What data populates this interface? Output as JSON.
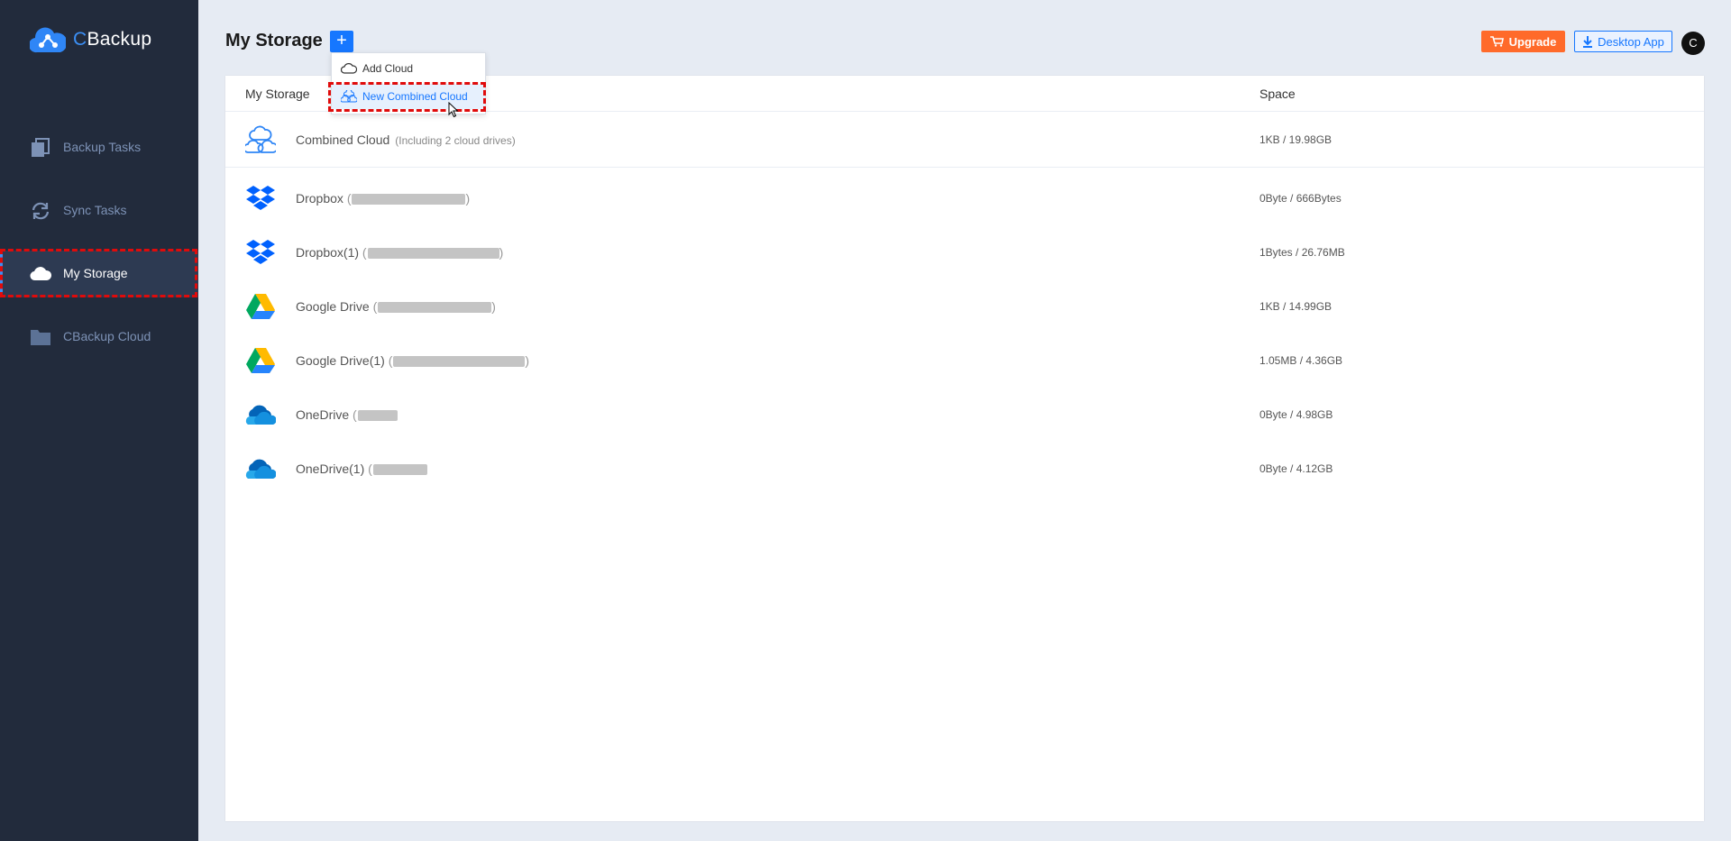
{
  "app": {
    "logo_first": "C",
    "logo_rest": "Backup"
  },
  "colors": {
    "sidebar_bg": "#222b3c",
    "accent": "#1677ff",
    "upgrade": "#ff6a2a",
    "highlight": "#e00b0b"
  },
  "sidebar": {
    "items": [
      {
        "label": "Backup Tasks",
        "icon": "backup-tasks-icon"
      },
      {
        "label": "Sync Tasks",
        "icon": "sync-icon"
      },
      {
        "label": "My Storage",
        "icon": "cloud-icon",
        "active": true
      },
      {
        "label": "CBackup Cloud",
        "icon": "folder-icon"
      }
    ]
  },
  "header": {
    "title": "My Storage",
    "add_label": "+",
    "upgrade_label": "Upgrade",
    "desktop_label": "Desktop App",
    "avatar_letter": "C"
  },
  "dropdown": {
    "items": [
      {
        "label": "Add Cloud",
        "icon": "cloud-outline-icon"
      },
      {
        "label": "New Combined Cloud",
        "icon": "combined-cloud-icon"
      }
    ]
  },
  "table": {
    "col_storage": "My Storage",
    "col_space": "Space",
    "rows": [
      {
        "name": "Combined Cloud",
        "sub": "(Including 2 cloud drives)",
        "space": "1KB / 19.98GB",
        "icon": "combined-cloud-icon"
      },
      {
        "name": "Dropbox",
        "open_paren": "(",
        "close_paren": ")",
        "space": "0Byte / 666Bytes",
        "icon": "dropbox-icon"
      },
      {
        "name": "Dropbox(1)",
        "open_paren": "(",
        "close_paren": ")",
        "space": "1Bytes / 26.76MB",
        "icon": "dropbox-icon"
      },
      {
        "name": "Google Drive",
        "open_paren": "(",
        "close_paren": ")",
        "space": "1KB / 14.99GB",
        "icon": "google-drive-icon"
      },
      {
        "name": "Google Drive(1)",
        "open_paren": "(",
        "close_paren": ")",
        "space": "1.05MB / 4.36GB",
        "icon": "google-drive-icon"
      },
      {
        "name": "OneDrive",
        "open_paren": "(",
        "space": "0Byte / 4.98GB",
        "icon": "onedrive-icon"
      },
      {
        "name": "OneDrive(1)",
        "open_paren": "(",
        "space": "0Byte / 4.12GB",
        "icon": "onedrive-icon"
      }
    ]
  }
}
